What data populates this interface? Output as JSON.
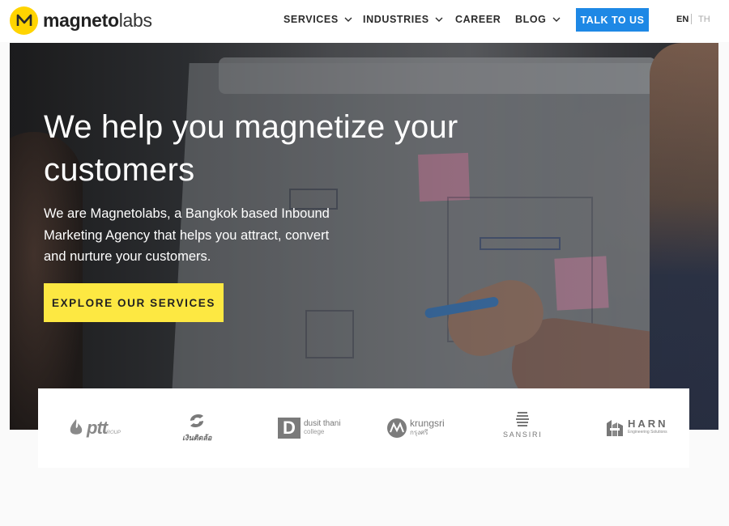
{
  "header": {
    "logo": {
      "bold_text": "magneto",
      "light_text": "labs",
      "badge_letter": "M",
      "badge_color": "#ffd400"
    },
    "nav": [
      {
        "label": "SERVICES",
        "has_dropdown": true
      },
      {
        "label": "INDUSTRIES",
        "has_dropdown": true
      },
      {
        "label": "CAREER",
        "has_dropdown": false
      },
      {
        "label": "BLOG",
        "has_dropdown": true
      }
    ],
    "cta_label": "TALK TO US",
    "cta_color": "#1e88e5",
    "lang": {
      "active": "EN",
      "inactive": "TH"
    }
  },
  "hero": {
    "headline": "We help you magnetize your customers",
    "subtext": "We are Magnetolabs, a Bangkok based Inbound Marketing Agency that helps you attract, convert and nurture your customers.",
    "button_label": "EXPLORE OUR SERVICES",
    "button_color": "#fde842"
  },
  "clients": {
    "ptt": {
      "name": "ptt",
      "sub": "GROUP"
    },
    "ngern": {
      "name": "เงินติดล้อ"
    },
    "dusit": {
      "letter": "D",
      "line1": "dusit thani",
      "line2": "college"
    },
    "krungsri": {
      "line1": "krungsri",
      "line2": "กรุงศรี"
    },
    "sansiri": {
      "name": "SANSIRI"
    },
    "harn": {
      "line1": "HARN",
      "line2": "Engineering Solutions"
    }
  }
}
